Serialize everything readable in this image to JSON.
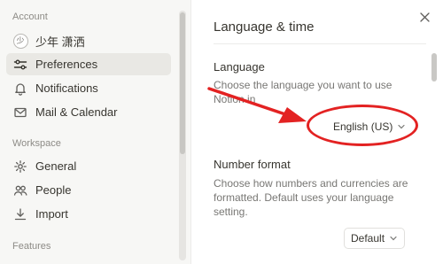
{
  "sidebar": {
    "account_label": "Account",
    "user_name": "少年 潇洒",
    "user_initial": "少",
    "items_account": [
      {
        "label": "Preferences",
        "icon": "sliders-icon",
        "active": true
      },
      {
        "label": "Notifications",
        "icon": "bell-icon"
      },
      {
        "label": "Mail & Calendar",
        "icon": "mail-icon"
      }
    ],
    "workspace_label": "Workspace",
    "items_workspace": [
      {
        "label": "General",
        "icon": "gear-icon"
      },
      {
        "label": "People",
        "icon": "people-icon"
      },
      {
        "label": "Import",
        "icon": "import-icon"
      }
    ],
    "features_label": "Features"
  },
  "main": {
    "title": "Language & time",
    "language": {
      "title": "Language",
      "description": "Choose the language you want to use Notion in",
      "selected": "English (US)"
    },
    "number_format": {
      "title": "Number format",
      "description": "Choose how numbers and currencies are formatted. Default uses your language setting.",
      "selected": "Default"
    }
  },
  "annotation": {
    "color": "#e32222"
  }
}
